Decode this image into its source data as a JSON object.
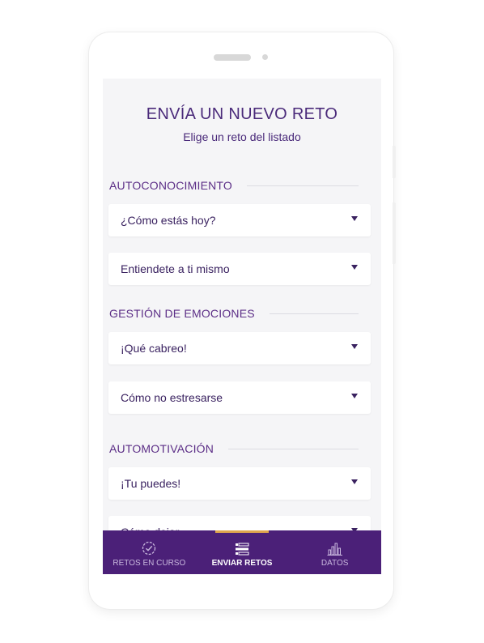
{
  "header": {
    "title": "ENVÍA UN NUEVO RETO",
    "subtitle": "Elige un reto del listado"
  },
  "sections": [
    {
      "title": "AUTOCONOCIMIENTO",
      "items": [
        "¿Cómo estás hoy?",
        "Entiendete a ti mismo"
      ]
    },
    {
      "title": "GESTIÓN DE EMOCIONES",
      "items": [
        "¡Qué cabreo!",
        "Cómo no estresarse"
      ]
    },
    {
      "title": "AUTOMOTIVACIÓN",
      "items": [
        "¡Tu puedes!",
        "Cómo dejar"
      ]
    }
  ],
  "tabs": [
    {
      "label": "RETOS EN CURSO",
      "icon": "check-badge-icon",
      "active": false
    },
    {
      "label": "ENVIAR RETOS",
      "icon": "list-send-icon",
      "active": true
    },
    {
      "label": "DATOS",
      "icon": "bar-chart-icon",
      "active": false
    }
  ],
  "colors": {
    "primary": "#4b2078",
    "accent": "#e0a64d",
    "text": "#3a2260"
  }
}
